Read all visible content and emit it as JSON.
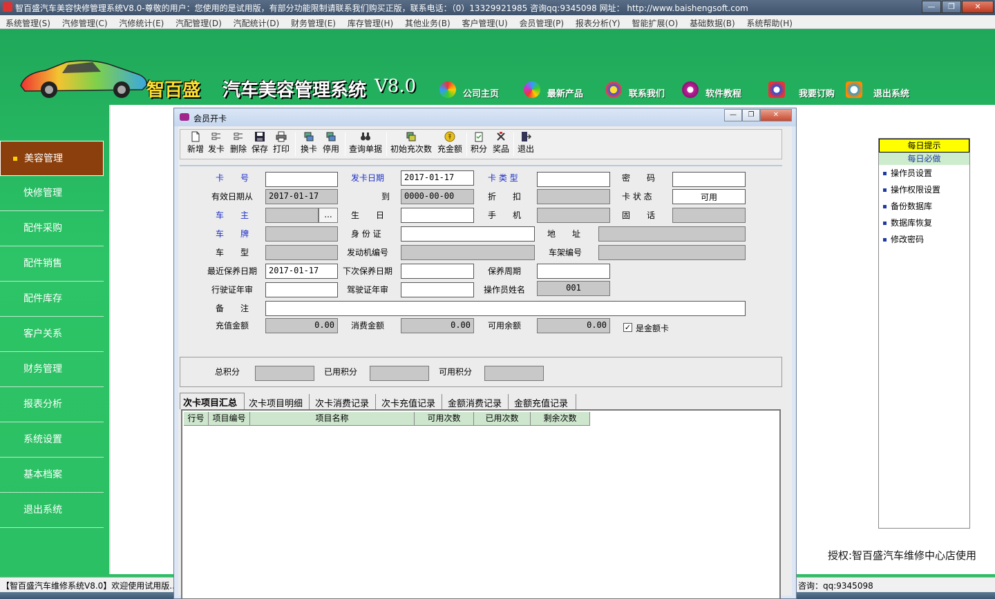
{
  "window": {
    "title": "智百盛汽车美容快修管理系统V8.0-尊敬的用户：您使用的是试用版，有部分功能限制请联系我们购买正版，联系电话：（0）13329921985  咨询qq:9345098   网址： http://www.baishengsoft.com",
    "min": "—",
    "max": "❐",
    "close": "✕"
  },
  "menu": [
    "系统管理(S)",
    "汽修管理(C)",
    "汽修统计(E)",
    "汽配管理(D)",
    "汽配统计(D)",
    "财务管理(E)",
    "库存管理(H)",
    "其他业务(B)",
    "客户管理(U)",
    "会员管理(P)",
    "报表分析(Y)",
    "智能扩展(O)",
    "基础数据(B)",
    "系统帮助(H)"
  ],
  "banner": {
    "brand": "智百盛",
    "system": "汽车美容管理系统",
    "version": "V8.0",
    "nav": [
      "公司主页",
      "最新产品",
      "联系我们",
      "软件教程",
      "我要订购",
      "退出系统"
    ]
  },
  "sidebar": [
    "美容管理",
    "快修管理",
    "配件采购",
    "配件销售",
    "配件库存",
    "客户关系",
    "财务管理",
    "报表分析",
    "系统设置",
    "基本档案",
    "退出系统"
  ],
  "tips": {
    "title": "每日提示",
    "subtitle": "每日必做",
    "items": [
      "操作员设置",
      "操作权限设置",
      "备份数据库",
      "数据库恢复",
      "修改密码"
    ]
  },
  "license": "授权:智百盛汽车维修中心店使用",
  "status": {
    "left": "【智百盛汽车维修系统V8.0】欢迎使用试用版...",
    "right": "咨询：qq:9345098"
  },
  "dialog": {
    "title": "会员开卡",
    "toolbar": [
      "新增",
      "发卡",
      "删除",
      "保存",
      "打印",
      "换卡",
      "停用",
      "查询单据",
      "初始充次数",
      "充金额",
      "积分",
      "奖品",
      "退出"
    ],
    "labels": {
      "card_no": "卡　　号",
      "issue_date": "发卡日期",
      "card_type": "卡 类 型",
      "password": "密　　码",
      "valid_from": "有效日期从",
      "to": "到",
      "discount": "折　　扣",
      "card_status": "卡 状 态",
      "owner": "车　　主",
      "birthday": "生　　日",
      "mobile": "手　　机",
      "phone": "固　　话",
      "plate": "车　　牌",
      "id_card": "身 份 证",
      "address": "地　　址",
      "model": "车　　型",
      "engine_no": "发动机编号",
      "frame_no": "车架编号",
      "last_maint": "最近保养日期",
      "next_maint": "下次保养日期",
      "maint_cycle": "保养周期",
      "license_check": "行驶证年审",
      "driver_check": "驾驶证年审",
      "operator": "操作员姓名",
      "remark": "备　　注",
      "recharge": "充值金额",
      "consume": "消费金额",
      "balance": "可用余额",
      "is_amount_card": "是金额卡",
      "total_points": "总积分",
      "used_points": "已用积分",
      "avail_points": "可用积分"
    },
    "values": {
      "issue_date": "2017-01-17",
      "valid_from": "2017-01-17",
      "valid_to": "0000-00-00",
      "card_status": "可用",
      "last_maint": "2017-01-17",
      "operator": "001",
      "recharge": "0.00",
      "consume": "0.00",
      "balance": "0.00",
      "dots": "..."
    },
    "tabs": [
      "次卡项目汇总",
      "次卡项目明细",
      "次卡消费记录",
      "次卡充值记录",
      "金额消费记录",
      "金额充值记录"
    ],
    "grid_headers": [
      "行号",
      "项目编号",
      "项目名称",
      "可用次数",
      "已用次数",
      "剩余次数"
    ]
  }
}
